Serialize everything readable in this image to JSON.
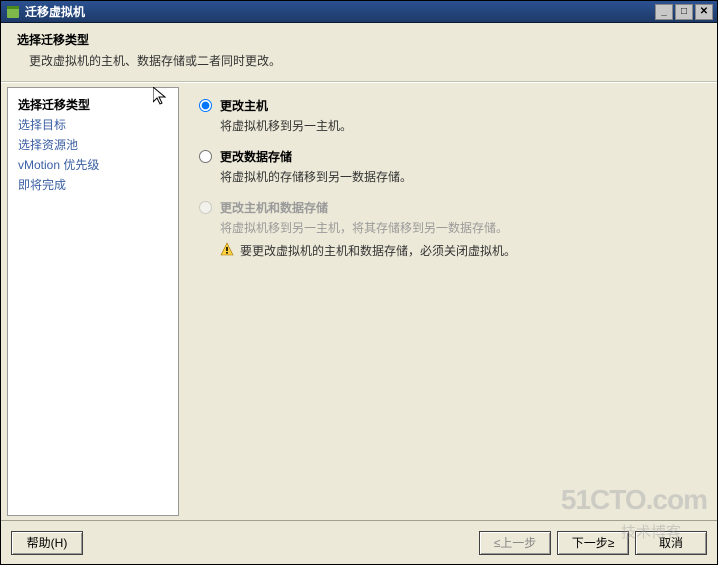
{
  "window": {
    "title": "迁移虚拟机"
  },
  "header": {
    "title": "选择迁移类型",
    "subtitle": "更改虚拟机的主机、数据存储或二者同时更改。"
  },
  "sidebar": {
    "steps": [
      "选择迁移类型",
      "选择目标",
      "选择资源池",
      "vMotion 优先级",
      "即将完成"
    ]
  },
  "options": {
    "host": {
      "label": "更改主机",
      "desc": "将虚拟机移到另一主机。"
    },
    "datastore": {
      "label": "更改数据存储",
      "desc": "将虚拟机的存储移到另一数据存储。"
    },
    "both": {
      "label": "更改主机和数据存储",
      "desc": "将虚拟机移到另一主机，将其存储移到另一数据存储。",
      "warn": "要更改虚拟机的主机和数据存储，必须关闭虚拟机。"
    }
  },
  "buttons": {
    "help": "帮助(H)",
    "back": "≤上一步",
    "next": "下一步≥",
    "cancel": "取消"
  },
  "watermark": {
    "main": "51CTO.com",
    "sub": "技术博客"
  }
}
